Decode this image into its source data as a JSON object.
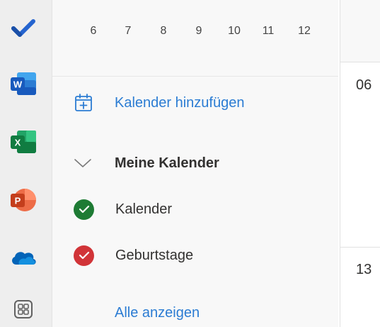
{
  "app_rail": {
    "items": [
      {
        "name": "To Do",
        "icon": "todo-check-icon",
        "color": "#2564cf"
      },
      {
        "name": "Word",
        "icon": "word-icon",
        "color": "#185abd",
        "letter": "W"
      },
      {
        "name": "Excel",
        "icon": "excel-icon",
        "color": "#107c41",
        "letter": "X"
      },
      {
        "name": "PowerPoint",
        "icon": "powerpoint-icon",
        "color": "#c43e1c",
        "letter": "P"
      },
      {
        "name": "OneDrive",
        "icon": "onedrive-icon",
        "color": "#0364b8"
      },
      {
        "name": "More apps",
        "icon": "apps-grid-icon",
        "color": "#616161"
      }
    ]
  },
  "mini_calendar": {
    "days": [
      "6",
      "7",
      "8",
      "9",
      "10",
      "11",
      "12"
    ]
  },
  "folder_pane": {
    "add_calendar_label": "Kalender hinzufügen",
    "add_calendar_icon": "calendar-add-icon",
    "section_title": "Meine Kalender",
    "section_icon": "chevron-down-icon",
    "calendars": [
      {
        "label": "Kalender",
        "color": "#1e7b34",
        "checked": true
      },
      {
        "label": "Geburtstage",
        "color": "#d13438",
        "checked": true
      }
    ],
    "show_all_label": "Alle anzeigen"
  },
  "calendar_grid": {
    "dates": [
      "06",
      "13"
    ]
  },
  "accent_color": "#2b7cd3"
}
